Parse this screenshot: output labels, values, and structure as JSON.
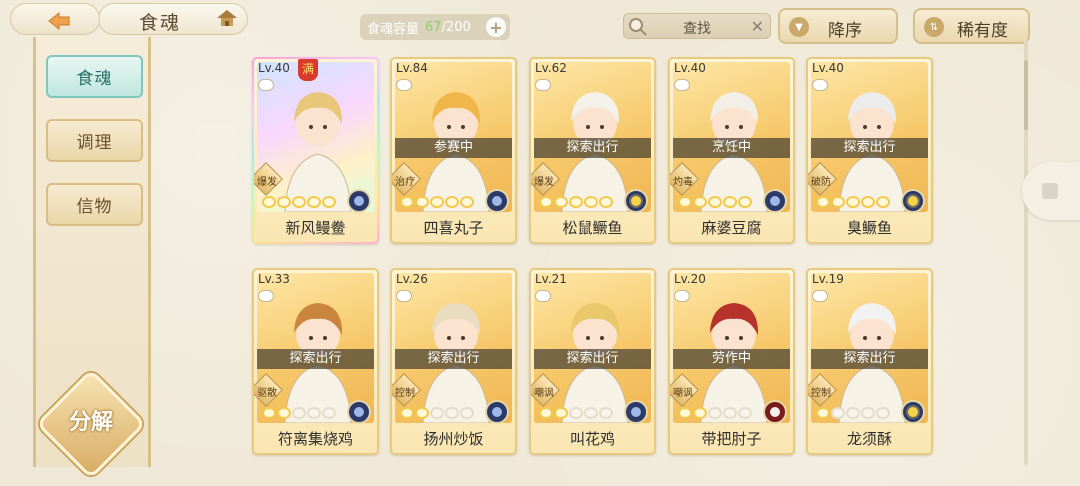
{
  "header": {
    "title": "食魂",
    "capacity_label": "食魂容量",
    "capacity_current": "67",
    "capacity_total": "/200",
    "capacity_add": "+",
    "search_placeholder": "查找",
    "search_clear": "✕",
    "sort_order": "降序",
    "sort_field": "稀有度"
  },
  "sidebar": {
    "items": [
      {
        "label": "食魂",
        "active": true
      },
      {
        "label": "调理",
        "active": false
      },
      {
        "label": "信物",
        "active": false
      }
    ],
    "decompose_label": "分解"
  },
  "cards": [
    {
      "level": "Lv.40",
      "name": "新风鳗鲞",
      "status": "",
      "role": "爆发",
      "max_badge": "满",
      "stars_filled": 5,
      "medal": "blue-flower",
      "frame": "rainbow",
      "hair": "#e8c77a"
    },
    {
      "level": "Lv.84",
      "name": "四喜丸子",
      "status": "参赛中",
      "role": "治疗",
      "stars_filled": 5,
      "medal": "blue-flower",
      "frame": "gold",
      "hair": "#f0b64a"
    },
    {
      "level": "Lv.62",
      "name": "松鼠鳜鱼",
      "status": "探索出行",
      "role": "爆发",
      "stars_filled": 5,
      "medal": "yellow-flower",
      "frame": "gold",
      "hair": "#f3f1ea"
    },
    {
      "level": "Lv.40",
      "name": "麻婆豆腐",
      "status": "烹饪中",
      "role": "灼毒",
      "stars_filled": 5,
      "medal": "blue-flower",
      "frame": "gold",
      "hair": "#f1efe8"
    },
    {
      "level": "Lv.40",
      "name": "臭鳜鱼",
      "status": "探索出行",
      "role": "破防",
      "stars_filled": 5,
      "medal": "yellow-flower",
      "frame": "gold",
      "hair": "#ececec"
    },
    {
      "level": "Lv.33",
      "name": "符离集烧鸡",
      "status": "探索出行",
      "role": "驱散",
      "stars_filled": 2,
      "medal": "blue-flower",
      "frame": "gold",
      "hair": "#c9853d"
    },
    {
      "level": "Lv.26",
      "name": "扬州炒饭",
      "status": "探索出行",
      "role": "控制",
      "stars_filled": 2,
      "medal": "blue-flower",
      "frame": "gold",
      "hair": "#e9dcc0"
    },
    {
      "level": "Lv.21",
      "name": "叫花鸡",
      "status": "探索出行",
      "role": "嘲讽",
      "stars_filled": 2,
      "medal": "blue-flower",
      "frame": "gold",
      "hair": "#e8c86a"
    },
    {
      "level": "Lv.20",
      "name": "带把肘子",
      "status": "劳作中",
      "role": "嘲讽",
      "stars_filled": 2,
      "medal": "red-flower",
      "frame": "gold",
      "hair": "#b8322c"
    },
    {
      "level": "Lv.19",
      "name": "龙须酥",
      "status": "探索出行",
      "role": "控制",
      "stars_filled": 1,
      "medal": "yellow-flower",
      "frame": "gold",
      "hair": "#f2f2f2"
    }
  ]
}
